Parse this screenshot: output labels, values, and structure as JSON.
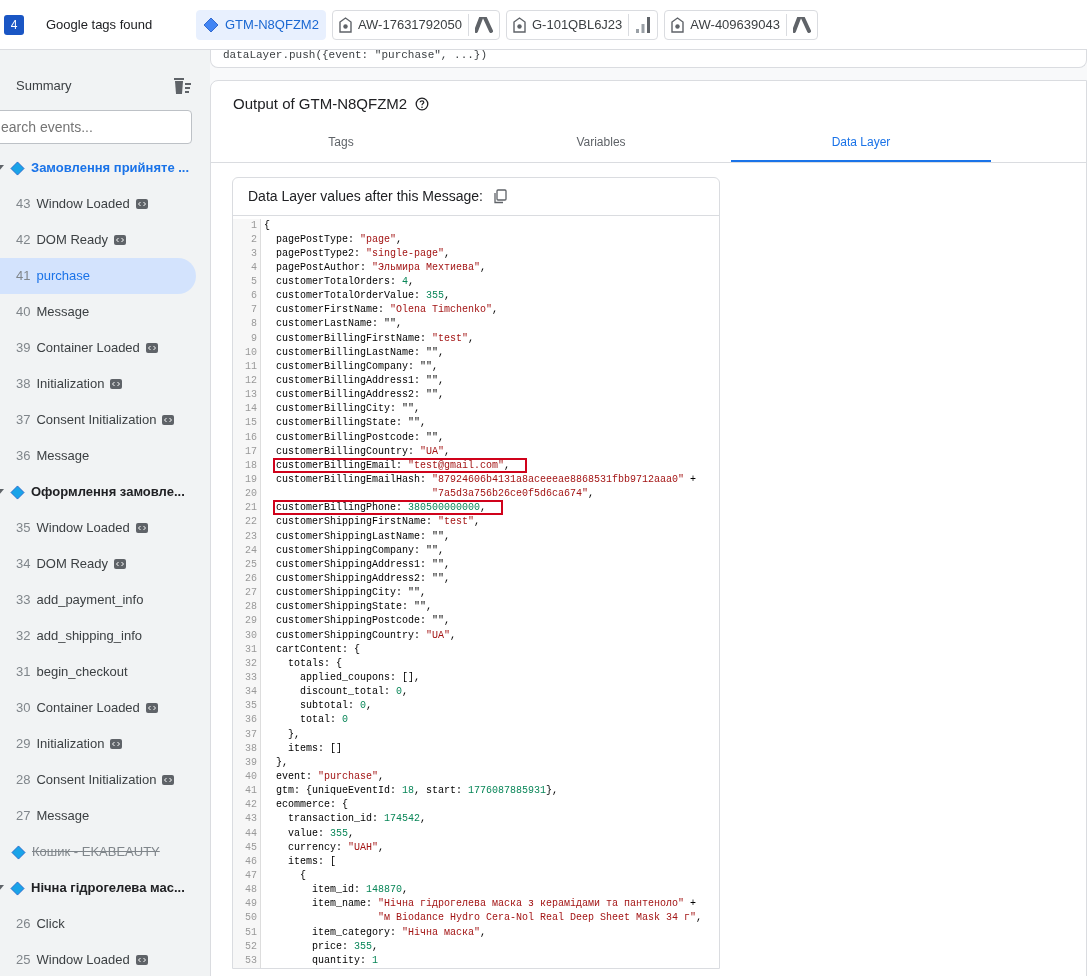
{
  "header": {
    "count": "4",
    "title": "Google tags found"
  },
  "tag_tabs": [
    {
      "kind": "gtm",
      "label": "GTM-N8QFZM2",
      "selected": true
    },
    {
      "kind": "ads",
      "label": "AW-17631792050",
      "selected": false
    },
    {
      "kind": "analytics",
      "label": "G-101QBL6J23",
      "selected": false
    },
    {
      "kind": "ads",
      "label": "AW-409639043",
      "selected": false
    }
  ],
  "sidebar": {
    "summary": "Summary",
    "search": {
      "placeholder": "earch events..."
    },
    "groups": [
      {
        "label": "Замовлення прийняте ...",
        "expanded": true,
        "struck": false,
        "children": [
          {
            "number": "43",
            "label": "Window Loaded",
            "badge": true,
            "selected": false
          },
          {
            "number": "42",
            "label": "DOM Ready",
            "badge": true,
            "selected": false
          },
          {
            "number": "41",
            "label": "purchase",
            "badge": false,
            "selected": true
          },
          {
            "number": "40",
            "label": "Message",
            "badge": false,
            "selected": false
          },
          {
            "number": "39",
            "label": "Container Loaded",
            "badge": true,
            "selected": false
          },
          {
            "number": "38",
            "label": "Initialization",
            "badge": true,
            "selected": false
          },
          {
            "number": "37",
            "label": "Consent Initialization",
            "badge": true,
            "selected": false
          },
          {
            "number": "36",
            "label": "Message",
            "badge": false,
            "selected": false
          }
        ]
      },
      {
        "label": "Оформлення замовле...",
        "expanded": true,
        "struck": false,
        "children": [
          {
            "number": "35",
            "label": "Window Loaded",
            "badge": true,
            "selected": false
          },
          {
            "number": "34",
            "label": "DOM Ready",
            "badge": true,
            "selected": false
          },
          {
            "number": "33",
            "label": "add_payment_info",
            "badge": false,
            "selected": false
          },
          {
            "number": "32",
            "label": "add_shipping_info",
            "badge": false,
            "selected": false
          },
          {
            "number": "31",
            "label": "begin_checkout",
            "badge": false,
            "selected": false
          },
          {
            "number": "30",
            "label": "Container Loaded",
            "badge": true,
            "selected": false
          },
          {
            "number": "29",
            "label": "Initialization",
            "badge": true,
            "selected": false
          },
          {
            "number": "28",
            "label": "Consent Initialization",
            "badge": true,
            "selected": false
          },
          {
            "number": "27",
            "label": "Message",
            "badge": false,
            "selected": false
          }
        ]
      },
      {
        "label": "Кошик - EKABEAUTY",
        "expanded": false,
        "struck": true
      },
      {
        "label": "Нічна гідрогелева мас...",
        "expanded": true,
        "struck": false,
        "children": [
          {
            "number": "26",
            "label": "Click",
            "badge": false,
            "selected": false
          },
          {
            "number": "25",
            "label": "Window Loaded",
            "badge": true,
            "selected": false
          }
        ]
      }
    ]
  },
  "message_card": {
    "code": "dataLayer.push({event: \"purchase\", ...})"
  },
  "output": {
    "title": "Output of GTM-N8QFZM2",
    "tabs": [
      {
        "label": "Tags",
        "selected": false
      },
      {
        "label": "Variables",
        "selected": false
      },
      {
        "label": "Data Layer",
        "selected": true
      }
    ],
    "data_layer": {
      "title": "Data Layer values after this Message:",
      "lines": [
        {
          "number": "1",
          "highlighted": false,
          "parts": [
            {
              "kind": "plain",
              "text": "{"
            }
          ]
        },
        {
          "number": "2",
          "highlighted": false,
          "parts": [
            {
              "kind": "plain",
              "text": "  pagePostType: "
            },
            {
              "kind": "string",
              "text": "\"page\""
            },
            {
              "kind": "plain",
              "text": ","
            }
          ]
        },
        {
          "number": "3",
          "highlighted": false,
          "parts": [
            {
              "kind": "plain",
              "text": "  pagePostType2: "
            },
            {
              "kind": "string",
              "text": "\"single-page\""
            },
            {
              "kind": "plain",
              "text": ","
            }
          ]
        },
        {
          "number": "4",
          "highlighted": false,
          "parts": [
            {
              "kind": "plain",
              "text": "  pagePostAuthor: "
            },
            {
              "kind": "string",
              "text": "\"Эльмира Мехтиева\""
            },
            {
              "kind": "plain",
              "text": ","
            }
          ]
        },
        {
          "number": "5",
          "highlighted": false,
          "parts": [
            {
              "kind": "plain",
              "text": "  customerTotalOrders: "
            },
            {
              "kind": "number",
              "text": "4"
            },
            {
              "kind": "plain",
              "text": ","
            }
          ]
        },
        {
          "number": "6",
          "highlighted": false,
          "parts": [
            {
              "kind": "plain",
              "text": "  customerTotalOrderValue: "
            },
            {
              "kind": "number",
              "text": "355"
            },
            {
              "kind": "plain",
              "text": ","
            }
          ]
        },
        {
          "number": "7",
          "highlighted": false,
          "parts": [
            {
              "kind": "plain",
              "text": "  customerFirstName: "
            },
            {
              "kind": "string",
              "text": "\"Olena Timchenko\""
            },
            {
              "kind": "plain",
              "text": ","
            }
          ]
        },
        {
          "number": "8",
          "highlighted": false,
          "parts": [
            {
              "kind": "plain",
              "text": "  customerLastName: \"\","
            }
          ]
        },
        {
          "number": "9",
          "highlighted": false,
          "parts": [
            {
              "kind": "plain",
              "text": "  customerBillingFirstName: "
            },
            {
              "kind": "string",
              "text": "\"test\""
            },
            {
              "kind": "plain",
              "text": ","
            }
          ]
        },
        {
          "number": "10",
          "highlighted": false,
          "parts": [
            {
              "kind": "plain",
              "text": "  customerBillingLastName: \"\","
            }
          ]
        },
        {
          "number": "11",
          "highlighted": false,
          "parts": [
            {
              "kind": "plain",
              "text": "  customerBillingCompany: \"\","
            }
          ]
        },
        {
          "number": "12",
          "highlighted": false,
          "parts": [
            {
              "kind": "plain",
              "text": "  customerBillingAddress1: \"\","
            }
          ]
        },
        {
          "number": "13",
          "highlighted": false,
          "parts": [
            {
              "kind": "plain",
              "text": "  customerBillingAddress2: \"\","
            }
          ]
        },
        {
          "number": "14",
          "highlighted": false,
          "parts": [
            {
              "kind": "plain",
              "text": "  customerBillingCity: \"\","
            }
          ]
        },
        {
          "number": "15",
          "highlighted": false,
          "parts": [
            {
              "kind": "plain",
              "text": "  customerBillingState: \"\","
            }
          ]
        },
        {
          "number": "16",
          "highlighted": false,
          "parts": [
            {
              "kind": "plain",
              "text": "  customerBillingPostcode: \"\","
            }
          ]
        },
        {
          "number": "17",
          "highlighted": false,
          "parts": [
            {
              "kind": "plain",
              "text": "  customerBillingCountry: "
            },
            {
              "kind": "string",
              "text": "\"UA\""
            },
            {
              "kind": "plain",
              "text": ","
            }
          ]
        },
        {
          "number": "18",
          "highlighted": true,
          "parts": [
            {
              "kind": "plain",
              "text": "  customerBillingEmail: "
            },
            {
              "kind": "string",
              "text": "\"test@gmail.com\""
            },
            {
              "kind": "plain",
              "text": ","
            }
          ]
        },
        {
          "number": "19",
          "highlighted": false,
          "parts": [
            {
              "kind": "plain",
              "text": "  customerBillingEmailHash: "
            },
            {
              "kind": "string",
              "text": "\"87924606b4131a8aceeeae8868531fbb9712aaa0\""
            },
            {
              "kind": "plain",
              "text": " +"
            }
          ]
        },
        {
          "number": "20",
          "highlighted": false,
          "parts": [
            {
              "kind": "string",
              "text": "                            \"7a5d3a756b26ce0f5d6ca674\""
            },
            {
              "kind": "plain",
              "text": ","
            }
          ]
        },
        {
          "number": "21",
          "highlighted": true,
          "parts": [
            {
              "kind": "plain",
              "text": "  customerBillingPhone: "
            },
            {
              "kind": "number",
              "text": "380500000000"
            },
            {
              "kind": "plain",
              "text": ","
            }
          ]
        },
        {
          "number": "22",
          "highlighted": false,
          "parts": [
            {
              "kind": "plain",
              "text": "  customerShippingFirstName: "
            },
            {
              "kind": "string",
              "text": "\"test\""
            },
            {
              "kind": "plain",
              "text": ","
            }
          ]
        },
        {
          "number": "23",
          "highlighted": false,
          "parts": [
            {
              "kind": "plain",
              "text": "  customerShippingLastName: \"\","
            }
          ]
        },
        {
          "number": "24",
          "highlighted": false,
          "parts": [
            {
              "kind": "plain",
              "text": "  customerShippingCompany: \"\","
            }
          ]
        },
        {
          "number": "25",
          "highlighted": false,
          "parts": [
            {
              "kind": "plain",
              "text": "  customerShippingAddress1: \"\","
            }
          ]
        },
        {
          "number": "26",
          "highlighted": false,
          "parts": [
            {
              "kind": "plain",
              "text": "  customerShippingAddress2: \"\","
            }
          ]
        },
        {
          "number": "27",
          "highlighted": false,
          "parts": [
            {
              "kind": "plain",
              "text": "  customerShippingCity: \"\","
            }
          ]
        },
        {
          "number": "28",
          "highlighted": false,
          "parts": [
            {
              "kind": "plain",
              "text": "  customerShippingState: \"\","
            }
          ]
        },
        {
          "number": "29",
          "highlighted": false,
          "parts": [
            {
              "kind": "plain",
              "text": "  customerShippingPostcode: \"\","
            }
          ]
        },
        {
          "number": "30",
          "highlighted": false,
          "parts": [
            {
              "kind": "plain",
              "text": "  customerShippingCountry: "
            },
            {
              "kind": "string",
              "text": "\"UA\""
            },
            {
              "kind": "plain",
              "text": ","
            }
          ]
        },
        {
          "number": "31",
          "highlighted": false,
          "parts": [
            {
              "kind": "plain",
              "text": "  cartContent: {"
            }
          ]
        },
        {
          "number": "32",
          "highlighted": false,
          "parts": [
            {
              "kind": "plain",
              "text": "    totals: {"
            }
          ]
        },
        {
          "number": "33",
          "highlighted": false,
          "parts": [
            {
              "kind": "plain",
              "text": "      applied_coupons: [],"
            }
          ]
        },
        {
          "number": "34",
          "highlighted": false,
          "parts": [
            {
              "kind": "plain",
              "text": "      discount_total: "
            },
            {
              "kind": "number",
              "text": "0"
            },
            {
              "kind": "plain",
              "text": ","
            }
          ]
        },
        {
          "number": "35",
          "highlighted": false,
          "parts": [
            {
              "kind": "plain",
              "text": "      subtotal: "
            },
            {
              "kind": "number",
              "text": "0"
            },
            {
              "kind": "plain",
              "text": ","
            }
          ]
        },
        {
          "number": "36",
          "highlighted": false,
          "parts": [
            {
              "kind": "plain",
              "text": "      total: "
            },
            {
              "kind": "number",
              "text": "0"
            }
          ]
        },
        {
          "number": "37",
          "highlighted": false,
          "parts": [
            {
              "kind": "plain",
              "text": "    },"
            }
          ]
        },
        {
          "number": "38",
          "highlighted": false,
          "parts": [
            {
              "kind": "plain",
              "text": "    items: []"
            }
          ]
        },
        {
          "number": "39",
          "highlighted": false,
          "parts": [
            {
              "kind": "plain",
              "text": "  },"
            }
          ]
        },
        {
          "number": "40",
          "highlighted": false,
          "parts": [
            {
              "kind": "plain",
              "text": "  event: "
            },
            {
              "kind": "string",
              "text": "\"purchase\""
            },
            {
              "kind": "plain",
              "text": ","
            }
          ]
        },
        {
          "number": "41",
          "highlighted": false,
          "parts": [
            {
              "kind": "plain",
              "text": "  gtm: {uniqueEventId: "
            },
            {
              "kind": "number",
              "text": "18"
            },
            {
              "kind": "plain",
              "text": ", start: "
            },
            {
              "kind": "number",
              "text": "1776087885931"
            },
            {
              "kind": "plain",
              "text": "},"
            }
          ]
        },
        {
          "number": "42",
          "highlighted": false,
          "parts": [
            {
              "kind": "plain",
              "text": "  ecommerce: {"
            }
          ]
        },
        {
          "number": "43",
          "highlighted": false,
          "parts": [
            {
              "kind": "plain",
              "text": "    transaction_id: "
            },
            {
              "kind": "number",
              "text": "174542"
            },
            {
              "kind": "plain",
              "text": ","
            }
          ]
        },
        {
          "number": "44",
          "highlighted": false,
          "parts": [
            {
              "kind": "plain",
              "text": "    value: "
            },
            {
              "kind": "number",
              "text": "355"
            },
            {
              "kind": "plain",
              "text": ","
            }
          ]
        },
        {
          "number": "45",
          "highlighted": false,
          "parts": [
            {
              "kind": "plain",
              "text": "    currency: "
            },
            {
              "kind": "string",
              "text": "\"UAH\""
            },
            {
              "kind": "plain",
              "text": ","
            }
          ]
        },
        {
          "number": "46",
          "highlighted": false,
          "parts": [
            {
              "kind": "plain",
              "text": "    items: ["
            }
          ]
        },
        {
          "number": "47",
          "highlighted": false,
          "parts": [
            {
              "kind": "plain",
              "text": "      {"
            }
          ]
        },
        {
          "number": "48",
          "highlighted": false,
          "parts": [
            {
              "kind": "plain",
              "text": "        item_id: "
            },
            {
              "kind": "number",
              "text": "148870"
            },
            {
              "kind": "plain",
              "text": ","
            }
          ]
        },
        {
          "number": "49",
          "highlighted": false,
          "parts": [
            {
              "kind": "plain",
              "text": "        item_name: "
            },
            {
              "kind": "string",
              "text": "\"Нічна гідрогелева маска з керамідами та пантеноло\""
            },
            {
              "kind": "plain",
              "text": " +"
            }
          ]
        },
        {
          "number": "50",
          "highlighted": false,
          "parts": [
            {
              "kind": "string",
              "text": "                   \"м Biodance Hydro Cera-Nol Real Deep Sheet Mask 34 г\""
            },
            {
              "kind": "plain",
              "text": ","
            }
          ]
        },
        {
          "number": "51",
          "highlighted": false,
          "parts": [
            {
              "kind": "plain",
              "text": "        item_category: "
            },
            {
              "kind": "string",
              "text": "\"Нічна маска\""
            },
            {
              "kind": "plain",
              "text": ","
            }
          ]
        },
        {
          "number": "52",
          "highlighted": false,
          "parts": [
            {
              "kind": "plain",
              "text": "        price: "
            },
            {
              "kind": "number",
              "text": "355"
            },
            {
              "kind": "plain",
              "text": ","
            }
          ]
        },
        {
          "number": "53",
          "highlighted": false,
          "parts": [
            {
              "kind": "plain",
              "text": "        quantity: "
            },
            {
              "kind": "number",
              "text": "1"
            }
          ]
        }
      ]
    }
  }
}
